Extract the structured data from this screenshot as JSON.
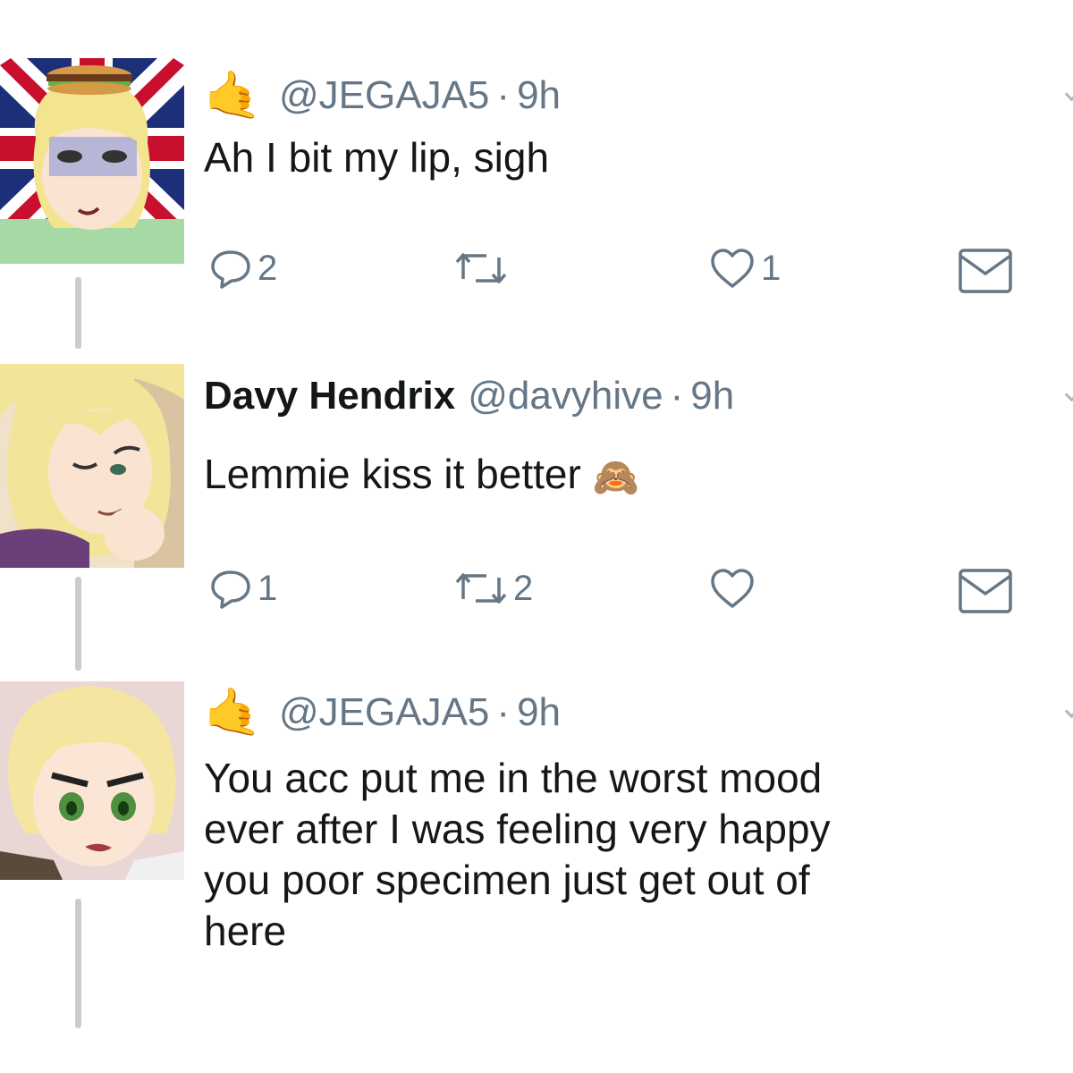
{
  "tweets": [
    {
      "name": "",
      "handle": "@JEGAJA5",
      "separator": "·",
      "time": "9h",
      "text_lines": [
        "Ah I bit my lip, sigh"
      ],
      "emoji": "",
      "reply_count": "2",
      "retweet_count": "",
      "like_count": "1"
    },
    {
      "name": "Davy Hendrix",
      "handle": "@davyhive",
      "separator": "·",
      "time": "9h",
      "text_lines": [
        "Lemmie kiss it better"
      ],
      "emoji": "🙈",
      "reply_count": "1",
      "retweet_count": "2",
      "like_count": ""
    },
    {
      "name": "",
      "handle": "@JEGAJA5",
      "separator": "·",
      "time": "9h",
      "text_lines": [
        "You acc put me in the worst mood",
        "ever after I was feeling very happy",
        "you poor specimen just get out of",
        "here"
      ],
      "emoji": "",
      "reply_count": "",
      "retweet_count": "",
      "like_count": ""
    }
  ],
  "name_emoji": "🤙",
  "icons": [
    "reply-icon",
    "retweet-icon",
    "like-icon",
    "message-icon",
    "caret-down-icon"
  ],
  "colors": {
    "text": "#14171a",
    "muted": "#657786",
    "thread_line": "#c8ccd0",
    "background": "#ffffff"
  }
}
